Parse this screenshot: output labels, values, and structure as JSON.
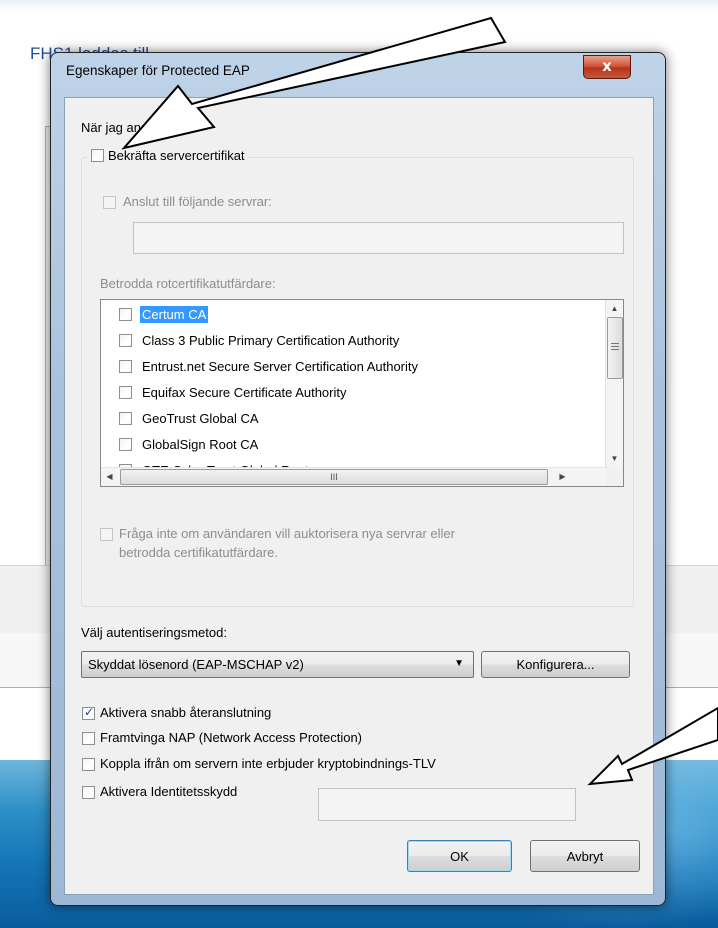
{
  "background": {
    "window_title": "FHS1 laddas till"
  },
  "dialog": {
    "title": "Egenskaper för Protected EAP",
    "close_glyph": "x",
    "intro_label": "När jag ansluter:",
    "verify_cert": {
      "label": "Bekräfta servercertifikat",
      "checked": false
    },
    "connect_servers": {
      "label": "Anslut till följande servrar:",
      "checked": false,
      "value": ""
    },
    "trusted_ca_label": "Betrodda rotcertifikatutfärdare:",
    "ca_list": [
      {
        "name": "Certum CA",
        "checked": false,
        "selected": true
      },
      {
        "name": "Class 3 Public Primary Certification Authority",
        "checked": false,
        "selected": false
      },
      {
        "name": "Entrust.net Secure Server Certification Authority",
        "checked": false,
        "selected": false
      },
      {
        "name": "Equifax Secure Certificate Authority",
        "checked": false,
        "selected": false
      },
      {
        "name": "GeoTrust Global CA",
        "checked": false,
        "selected": false
      },
      {
        "name": "GlobalSign Root CA",
        "checked": false,
        "selected": false
      },
      {
        "name": "GTE CyberTrust Global Root",
        "checked": false,
        "selected": false
      }
    ],
    "dont_prompt": {
      "line1": "Fråga inte om användaren vill auktorisera nya servrar eller",
      "line2": "betrodda certifikatutfärdare.",
      "checked": false
    },
    "auth_method_label": "Välj autentiseringsmetod:",
    "auth_method_value": "Skyddat lösenord (EAP-MSCHAP v2)",
    "configure_button": "Konfigurera...",
    "options": [
      {
        "label": "Aktivera snabb återanslutning",
        "checked": true
      },
      {
        "label": "Framtvinga NAP (Network Access Protection)",
        "checked": false
      },
      {
        "label": "Koppla ifrån om servern inte erbjuder kryptobindnings-TLV",
        "checked": false
      },
      {
        "label": "Aktivera Identitetsskydd",
        "checked": false
      }
    ],
    "identity_value": "",
    "ok_button": "OK",
    "cancel_button": "Avbryt"
  },
  "scroll_glyphs": {
    "up": "▲",
    "down": "▼",
    "left": "◀",
    "right": "▶",
    "grip": "III"
  },
  "colors": {
    "selection": "#3399ff",
    "close_button": "#c7462a",
    "taskbar": "#1273b5"
  }
}
